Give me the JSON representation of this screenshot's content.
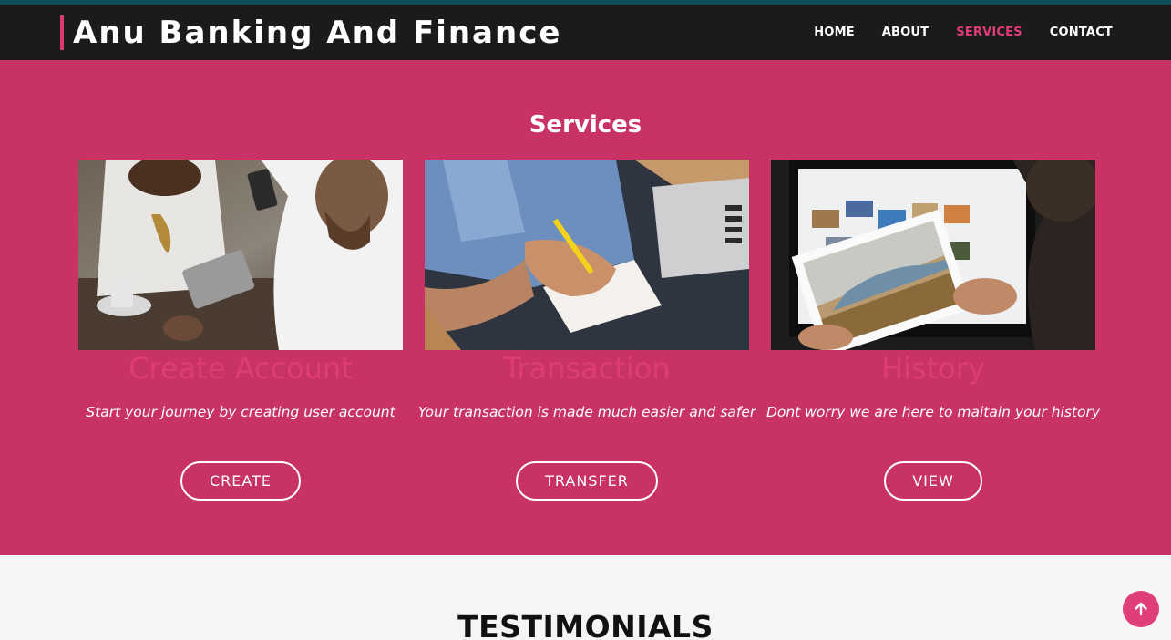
{
  "brand": {
    "name": "Anu Banking And Finance"
  },
  "nav": {
    "items": [
      {
        "label": "HOME",
        "active": false
      },
      {
        "label": "ABOUT",
        "active": false
      },
      {
        "label": "SERVICES",
        "active": true
      },
      {
        "label": "CONTACT",
        "active": false
      }
    ]
  },
  "services": {
    "title": "Services",
    "cards": [
      {
        "title": "Create Account",
        "description": "Start your journey by creating user account",
        "button": "CREATE",
        "image": "people-with-phone-and-tablet-photo"
      },
      {
        "title": "Transaction",
        "description": "Your transaction is made much easier and safer",
        "button": "TRANSFER",
        "image": "person-writing-cheque-photo"
      },
      {
        "title": "History",
        "description": "Dont worry we are here to maitain your history",
        "button": "VIEW",
        "image": "person-holding-photo-print-photo"
      }
    ]
  },
  "testimonials": {
    "title": "TESTIMONIALS"
  },
  "scroll_top": {
    "icon": "arrow-up-icon"
  },
  "colors": {
    "accent": "#c93265",
    "nav_bg": "#1b1b1b",
    "active_link": "#e03a79"
  }
}
